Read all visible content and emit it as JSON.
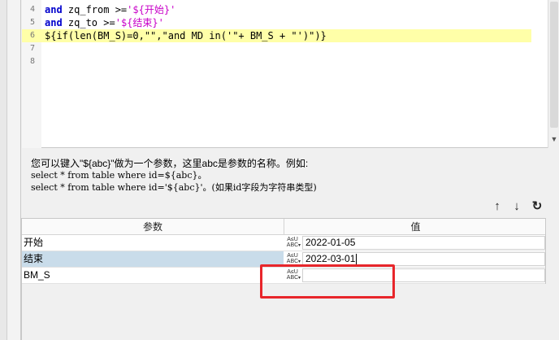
{
  "editor": {
    "lines": [
      {
        "num": "4",
        "parts": [
          {
            "t": "and",
            "c": "kw"
          },
          {
            "t": " zq_from >=",
            "c": "code-black"
          },
          {
            "t": "'${开始}'",
            "c": "str"
          }
        ]
      },
      {
        "num": "5",
        "parts": [
          {
            "t": "and",
            "c": "kw"
          },
          {
            "t": " zq_to >=",
            "c": "code-black"
          },
          {
            "t": "'${结束}'",
            "c": "str"
          }
        ]
      },
      {
        "num": "6",
        "parts": [
          {
            "t": "${if(len(BM_S)=0,\"\",\"and MD in('\"+ BM_S + \"')\")}",
            "c": "code-black"
          }
        ]
      },
      {
        "num": "7",
        "parts": []
      },
      {
        "num": "8",
        "parts": []
      }
    ]
  },
  "hint": {
    "line1": "您可以键入\"${abc}\"做为一个参数，这里abc是参数的名称。例如:",
    "line2": "select * from table where id=${abc}。",
    "line3": "select * from table where id='${abc}'。(如果id字段为字符串类型)"
  },
  "toolbar": {
    "up_icon": "arrow-up-icon",
    "down_icon": "arrow-down-icon",
    "refresh_icon": "refresh-icon"
  },
  "table": {
    "col_param": "参数",
    "col_value": "值",
    "type_label_top": "A≤U",
    "type_label_bottom": "ABC",
    "rows": [
      {
        "name": "开始",
        "value": "2022-01-05"
      },
      {
        "name": "结束",
        "value": "2022-03-01"
      },
      {
        "name": "BM_S",
        "value": ""
      }
    ]
  },
  "colors": {
    "highlight_line": "#ffffa8",
    "selected_row": "#c9dcea",
    "annotation_box": "#e8262b"
  }
}
